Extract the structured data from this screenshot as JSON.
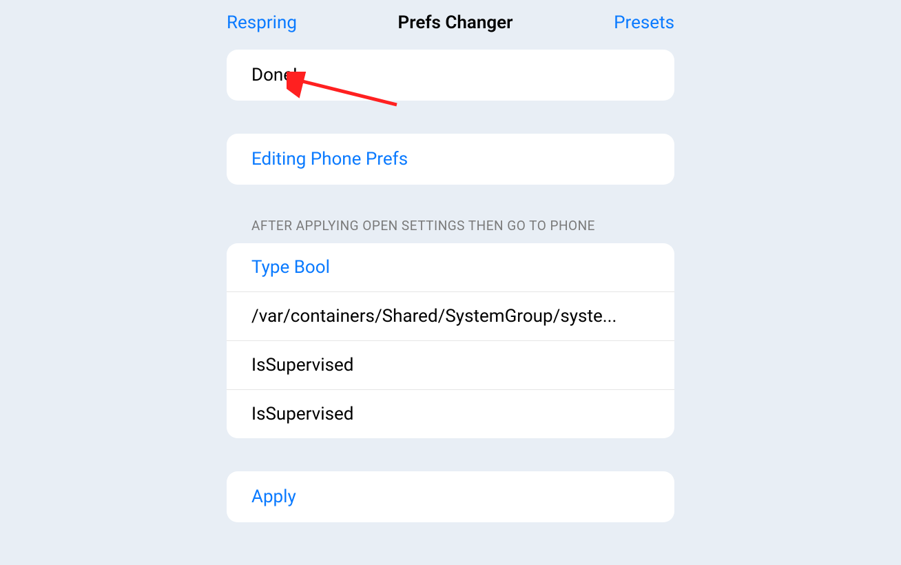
{
  "nav": {
    "left": "Respring",
    "title": "Prefs Changer",
    "right": "Presets"
  },
  "status": {
    "message": "Done!"
  },
  "editing": {
    "label": "Editing Phone Prefs"
  },
  "section": {
    "header": "AFTER APPLYING OPEN SETTINGS THEN GO TO PHONE"
  },
  "details": {
    "type": "Type Bool",
    "path": "/var/containers/Shared/SystemGroup/syste...",
    "key1": "IsSupervised",
    "key2": "IsSupervised"
  },
  "apply": {
    "label": "Apply"
  }
}
